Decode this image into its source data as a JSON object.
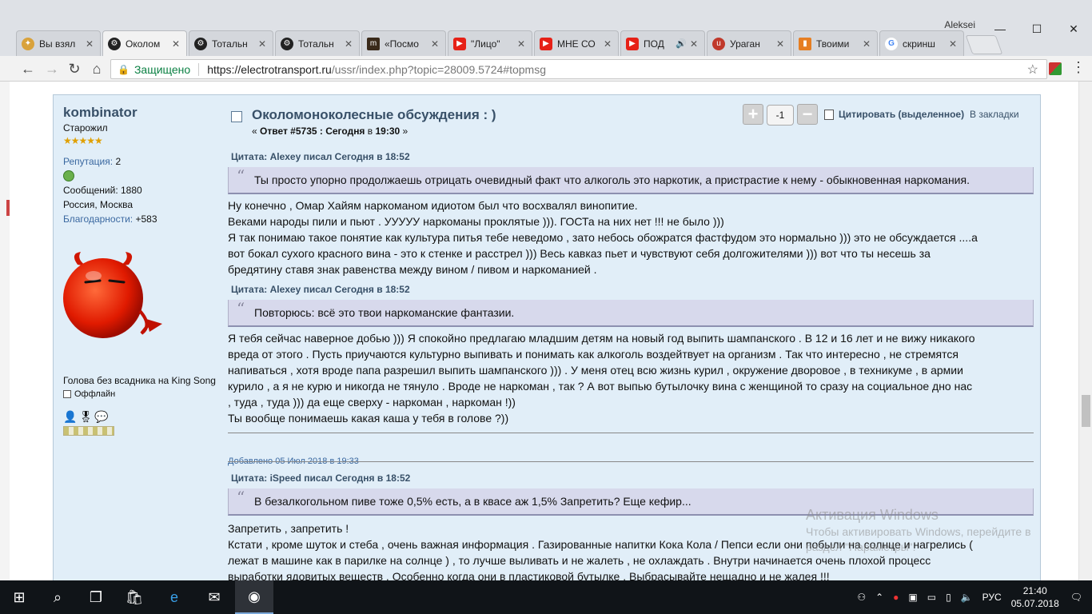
{
  "window": {
    "user": "Aleksei",
    "min_glyph": "—",
    "max_glyph": "☐",
    "close_glyph": "✕"
  },
  "tabs": [
    {
      "title": "Вы взял",
      "icon": "pigeon-icon",
      "color": "#d9a23b",
      "active": false
    },
    {
      "title": "Околом",
      "icon": "wheel-icon",
      "color": "#222222",
      "active": true
    },
    {
      "title": "Тотальн",
      "icon": "wheel-icon",
      "color": "#222222",
      "active": false
    },
    {
      "title": "Тотальн",
      "icon": "wheel-icon",
      "color": "#222222",
      "active": false
    },
    {
      "title": "«Посмо",
      "icon": "m-icon",
      "color": "#3a2a1a",
      "active": false
    },
    {
      "title": "\"Лицо\"",
      "icon": "youtube-icon",
      "color": "#e62117",
      "active": false
    },
    {
      "title": "МНЕ СО",
      "icon": "youtube-icon",
      "color": "#e62117",
      "active": false
    },
    {
      "title": "ПОД",
      "icon": "youtube-icon",
      "color": "#e62117",
      "active": false
    },
    {
      "title": "Ураган",
      "icon": "u-icon",
      "color": "#c0392b",
      "active": false
    },
    {
      "title": "Твоими",
      "icon": "chart-icon",
      "color": "#e67e22",
      "active": false
    },
    {
      "title": "скринш",
      "icon": "google-icon",
      "color": "#4285f4",
      "active": false
    }
  ],
  "toolbar": {
    "secure_label": "Защищено",
    "url_host": "https://electrotransport.ru",
    "url_path": "/ussr/index.php?topic=28009.5724#topmsg"
  },
  "poster": {
    "name": "kombinator",
    "rank": "Старожил",
    "stars": "★★★★★",
    "reputation_label": "Репутация:",
    "reputation_value": "2",
    "messages": "Сообщений: 1880",
    "location": "Россия, Москва",
    "thanks_label": "Благодарности:",
    "thanks_value": "+583",
    "personal_text": "Голова без всадника на King Song",
    "status": "Оффлайн"
  },
  "post": {
    "title": "Околомоноколесные обсуждения : )",
    "sub_prefix": "« ",
    "reply_label": "Ответ #5735 :",
    "date": "Сегодня",
    "time_prefix": " в ",
    "time": "19:30",
    "sub_suffix": " »",
    "karma": "-1",
    "karma_plus": "+",
    "karma_minus": "−",
    "quote_button": "Цитировать (выделенное)",
    "bookmark_button": "В закладки",
    "added": "Добавлено 05 Июл 2018 в 19:33"
  },
  "quotes": [
    {
      "head": "Цитата: Alexey писал Сегодня в 18:52",
      "text": "Ты просто упорно продолжаешь отрицать очевидный факт что алкоголь это наркотик, а пристрастие к нему - обыкновенная наркомания."
    },
    {
      "head": "Цитата: Alexey писал Сегодня в 18:52",
      "text": "Повторюсь: всё это твои наркоманские фантазии."
    },
    {
      "head": "Цитата: iSpeed писал Сегодня в 18:52",
      "text": "В безалкогольном пиве тоже 0,5% есть, а в квасе аж 1,5%  Запретить? Еще кефир..."
    }
  ],
  "body1": [
    "Ну конечно , Омар Хайям наркоманом идиотом был что восхвалял винопитие.",
    "Веками народы  пили и пьют . УУУУУ наркоманы проклятые ))). ГОСТа на них нет !!! не было )))",
    "Я так понимаю такое понятие как культура питья тебе неведомо , зато небось обожратся фастфудом  это нормально ))) это не обсуждается ....а",
    "вот бокал сухого красного вина - это к стенке и расстрел ))) Весь кавказ пьет и чувствуют себя долгожителями ))) вот что ты несешь за",
    "бредятину ставя знак равенства между вином / пивом и наркоманией ."
  ],
  "body2": [
    "Я тебя сейчас наверное добью ))) Я спокойно предлагаю младшим детям на новый год выпить шампанского . В 12 и 16 лет и не вижу никакого",
    "вреда от этого . Пусть приучаются культурно выпивать и понимать как алкоголь воздейтвует на организм  . Так что интересно , не стремятся",
    "напиваться ,  хотя  вроде папа разрешил выпить шампанского  ))) . У меня отец всю жизнь курил , окружение дворовое , в техникуме , в армии",
    "курило , а я не курю и никогда не тянуло . Вроде не наркоман , так ? А вот выпью бутылочку вина с женщиной то сразу на социальное дно нас",
    ", туда , туда ))) да еще сверху - наркоман , наркоман !))",
    "Ты вообще понимаешь какая каша у тебя в голове ?))"
  ],
  "body3": [
    "Запретить , запретить !",
    "Кстати , кроме шуток и стеба , очень важная информация . Газированные напитки Кока Кола /  Пепси если они побыли на солнце и нагрелись (",
    "лежат в машине как в парилке на солнце )  , то лучше выливать и не жалеть , не охлаждать . Внутри начинается очень плохой процесс",
    "выработки ядовитых веществ . Особенно когда они в пластиковой бутылке . Выбрасывайте нещадно и не жалея !!!"
  ],
  "watermark": {
    "line1": "Активация Windows",
    "line2": "Чтобы активировать Windows, перейдите в",
    "line3": "раздел \"Параметры\"."
  },
  "taskbar": {
    "lang": "РУС",
    "time": "21:40",
    "date": "05.07.2018"
  }
}
